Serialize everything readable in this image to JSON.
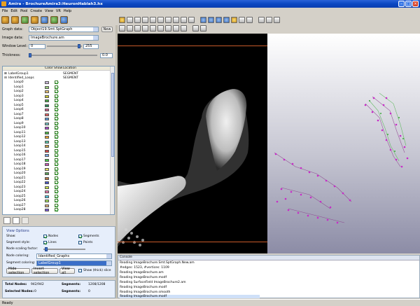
{
  "window": {
    "title": "Amira - BrochureAmira3:HeuronHablah3.hx"
  },
  "menu": [
    "File",
    "Edit",
    "Pool",
    "Create",
    "View",
    "VR",
    "Help"
  ],
  "properties": {
    "graph_data_label": "Graph data:",
    "graph_data_value": "Object19.Smt.SptGraph",
    "new_button": "New",
    "image_data_label": "Image data:",
    "image_data_value": "ImageBrochure.am",
    "window_level_label": "Window Level:",
    "window_level_min": "0",
    "window_level_max": "255",
    "thickness_label": "Thickness:",
    "thickness_value": "0.0"
  },
  "tree": {
    "col_color": "Color",
    "col_show": "Show",
    "col_location": "Location",
    "groups": [
      {
        "name": "LabelGroup1",
        "location": "SEGMENT"
      },
      {
        "name": "Identified_Loops",
        "location": "SEGMENT"
      }
    ],
    "loops": [
      "Loop0",
      "Loop1",
      "Loop2",
      "Loop3",
      "Loop4",
      "Loop5",
      "Loop6",
      "Loop7",
      "Loop8",
      "Loop9",
      "Loop10",
      "Loop11",
      "Loop12",
      "Loop13",
      "Loop14",
      "Loop15",
      "Loop16",
      "Loop17",
      "Loop18",
      "Loop19",
      "Loop20",
      "Loop21",
      "Loop22",
      "Loop23",
      "Loop24",
      "Loop25",
      "Loop26",
      "Loop27",
      "Loop28",
      "Loop29",
      "Loop30"
    ],
    "loop_colors": [
      "#c9b7d8",
      "#9ad07a",
      "#e8c070",
      "#c8c830",
      "#4aa848",
      "#2a8a58",
      "#d05a8a",
      "#e06060",
      "#5a9ad8",
      "#70c0c0",
      "#a848c8",
      "#48b848",
      "#e8a030",
      "#58c8a8",
      "#c8a048",
      "#d84848",
      "#78a8e8",
      "#48c848",
      "#c85ab8",
      "#e8e060",
      "#58a058",
      "#b87848",
      "#4858c8",
      "#c8e048",
      "#e878a8",
      "#50c8e0",
      "#a8e058",
      "#d8a878",
      "#7858d8",
      "#c83838",
      "#38a8a8"
    ]
  },
  "view_options": {
    "header": "View Options",
    "show_label": "Show:",
    "nodes": "Nodes",
    "segments": "Segments",
    "segment_style_label": "Segment style:",
    "lines": "Lines",
    "points": "Points",
    "node_scaling_label": "Node scaling factor:",
    "node_coloring_label": "Node coloring:",
    "node_coloring_value": "Identified_Graphs",
    "segment_coloring_label": "Segment coloring:",
    "segment_coloring_value": "LabelGroup1",
    "hide_selection": "Hide selection",
    "invert_selection": "Invert selection",
    "view_all": "View all",
    "show_slice": "Show (thick) slice"
  },
  "stats": {
    "total_nodes_label": "Total Nodes:",
    "total_nodes_value": "942/942",
    "segments_label": "Segments:",
    "segments_value": "1208/1208",
    "selected_nodes_label": "Selected Nodes:",
    "selected_nodes_value": "0",
    "selected_segments_label": "Segments:",
    "selected_segments_value": "0"
  },
  "console": {
    "header": "Console",
    "lines": [
      "Reading ImageBrochure.Smt.SptGraph.New.am",
      "#edges: 1523, #vertices: 1109",
      "Reading ImageBrochure.am",
      "Reading ImageBrochure.modf",
      "Reading SurfaceField ImageBrochure2.am",
      "Reading ImageBrochure.modf",
      "Reading ImageBrochure.smooth",
      "Reading ImageBrochure.modf"
    ]
  },
  "status": "Ready"
}
